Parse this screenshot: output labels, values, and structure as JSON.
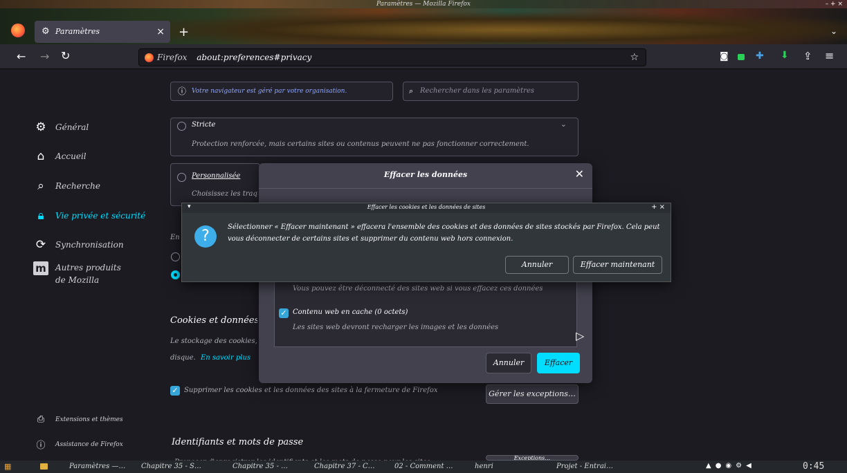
{
  "window": {
    "title": "Paramètres — Mozilla Firefox"
  },
  "tab": {
    "label": "Paramètres",
    "close": "×",
    "new": "+"
  },
  "toolbar": {
    "url_prefix": "Firefox",
    "url": "about:preferences#privacy"
  },
  "notice": {
    "text": "Votre navigateur est géré par votre organisation."
  },
  "search": {
    "placeholder": "Rechercher dans les paramètres"
  },
  "sidebar": {
    "items": [
      {
        "label": "Général",
        "icon": "gear-icon"
      },
      {
        "label": "Accueil",
        "icon": "home-icon"
      },
      {
        "label": "Recherche",
        "icon": "search-icon"
      },
      {
        "label": "Vie privée et sécurité",
        "icon": "lock-icon",
        "active": true
      },
      {
        "label": "Synchronisation",
        "icon": "sync-icon"
      },
      {
        "label": "Autres produits de Mozilla",
        "icon": "mozilla-icon"
      }
    ],
    "footer": [
      {
        "label": "Extensions et thèmes",
        "icon": "puzzle-icon"
      },
      {
        "label": "Assistance de Firefox",
        "icon": "help-icon"
      }
    ]
  },
  "strict": {
    "title": "Stricte",
    "desc": "Protection renforcée, mais certains sites ou contenus peuvent ne pas fonctionner correctement."
  },
  "custom": {
    "title": "Personnalisée",
    "desc": "Choisissez les traque"
  },
  "cookies": {
    "title": "Cookies et données de si",
    "desc": "Le stockage des cookies, du",
    "desc2": "disque.",
    "learn_more": "En savoir plus",
    "delete_on_close": "Supprimer les cookies et les données des sites à la fermeture de Firefox",
    "manage_exceptions": "Gérer les exceptions…",
    "cut_label": "En"
  },
  "credentials": {
    "title": "Identifiants et mots de passe",
    "partial": "Proposer d'enregistrer les identifiants et les mots de passe pour les sites web",
    "exceptions": "Exceptions…"
  },
  "clear_dialog": {
    "title": "Effacer les données",
    "cookies_note": "Vous pouvez être déconnecté des sites web si vous effacez ces données",
    "cache_label": "Contenu web en cache (0 octets)",
    "cache_note": "Les sites web devront recharger les images et les données",
    "cancel": "Annuler",
    "clear": "Effacer"
  },
  "confirm_dialog": {
    "title": "Effacer les cookies et les données de sites",
    "message": "Sélectionner « Effacer maintenant » effacera l'ensemble des cookies et des données de sites stockés par Firefox. Cela peut vous déconnecter de certains sites et supprimer du contenu web hors connexion.",
    "cancel": "Annuler",
    "confirm": "Effacer maintenant"
  },
  "taskbar": {
    "items": [
      "Paramètres —…",
      "Chapitre 35 - S…",
      "Chapitre 35 - …",
      "Chapitre 37 - C…",
      "02 - Comment …",
      "henri",
      "Projet - Entrai…"
    ],
    "clock": "0:45"
  }
}
